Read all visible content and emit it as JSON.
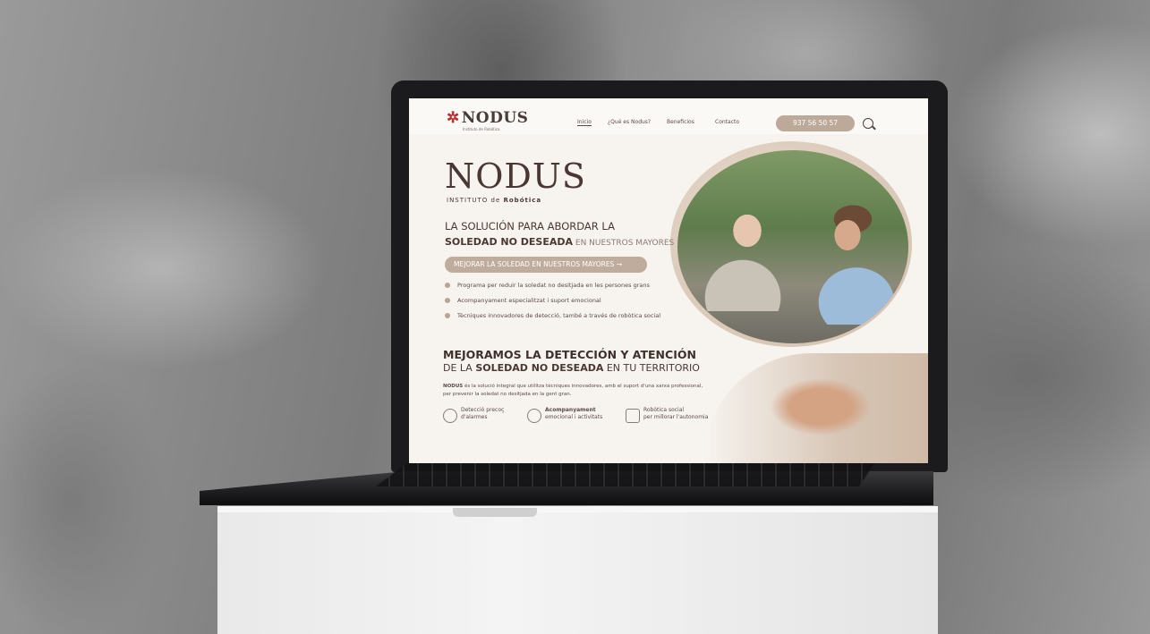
{
  "site": {
    "logo": "NODUS",
    "logo_sub": "Instituto de Robótica",
    "nav": [
      "Inicio",
      "¿Qué es Nodus?",
      "Beneficios",
      "Contacto"
    ],
    "phone": "937 56 50 57",
    "search_icon": "search-icon"
  },
  "hero": {
    "title": "NODUS",
    "subtitle_prefix": "INSTITUTO de ",
    "subtitle_bold": "Robótica",
    "line1": "LA SOLUCIÓN PARA ABORDAR LA",
    "line2_bold": "SOLEDAD NO DESEADA",
    "line2_rest": " EN NUESTROS MAYORES",
    "cta": "MEJORAR LA SOLEDAD EN NUESTROS MAYORES →",
    "bullets": [
      "Programa per reduir la soledat no desitjada en les persones grans",
      "Acompanyament especialitzat i suport emocional",
      "Tècniques innovadores de detecció, també a través de robòtica social"
    ]
  },
  "section2": {
    "title": "MEJORAMOS LA DETECCIÓN Y ATENCIÓN",
    "sub_prefix": "DE LA ",
    "sub_bold": "SOLEDAD NO DESEADA",
    "sub_rest": " EN TU TERRITORIO",
    "desc_bold": "NODUS",
    "desc": " és la solució integral que utilitza tècniques innovadores, amb el suport d'una xarxa professional, per prevenir la soledat no desitjada en la gent gran.",
    "features": [
      {
        "l1": "Detecció precoç",
        "l2": "d'alarmes"
      },
      {
        "l1": "Acompanyament",
        "l2": "emocional i activitats"
      },
      {
        "l1": "Robòtica social",
        "l2": "per millorar l'autonomia"
      }
    ]
  }
}
